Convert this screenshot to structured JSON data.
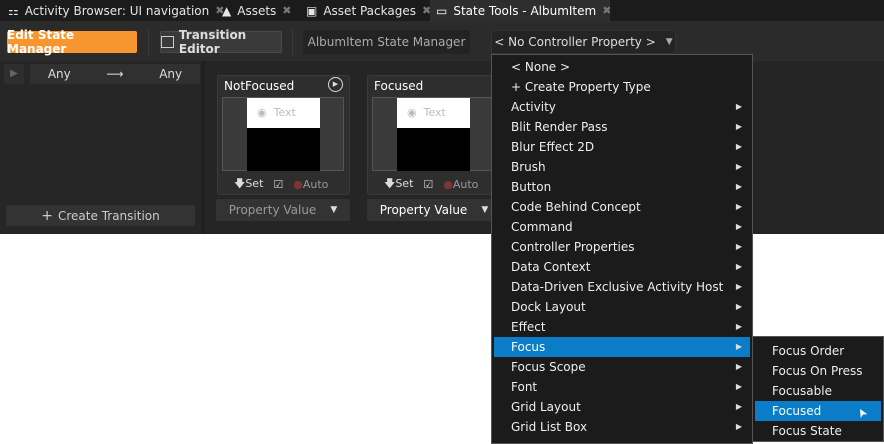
{
  "tabs": [
    {
      "label": "Activity Browser: UI navigation",
      "icon": "hierarchy-icon"
    },
    {
      "label": "Assets",
      "icon": "assets-icon"
    },
    {
      "label": "Asset Packages",
      "icon": "package-icon"
    },
    {
      "label": "State Tools - AlbumItem",
      "icon": "window-icon",
      "active": true
    }
  ],
  "toolbar": {
    "edit_state_manager": "Edit State Manager",
    "transition_editor": "Transition Editor",
    "state_manager_name": "AlbumItem State Manager",
    "controller_property": "< No Controller Property >"
  },
  "transitions": {
    "from": "Any",
    "to": "Any",
    "create": "Create Transition"
  },
  "states": [
    {
      "name": "NotFocused",
      "preview_text": "Text",
      "set": "Set",
      "auto": "Auto",
      "property_value": "Property Value"
    },
    {
      "name": "Focused",
      "preview_text": "Text",
      "set": "Set",
      "auto": "Auto",
      "property_value": "Property Value"
    }
  ],
  "menu": {
    "items": [
      {
        "label": "< None >",
        "sub": false
      },
      {
        "label": "+ Create Property Type",
        "sub": false
      },
      {
        "label": "Activity",
        "sub": true
      },
      {
        "label": "Blit Render Pass",
        "sub": true
      },
      {
        "label": "Blur Effect 2D",
        "sub": true
      },
      {
        "label": "Brush",
        "sub": true
      },
      {
        "label": "Button",
        "sub": true
      },
      {
        "label": "Code Behind Concept",
        "sub": true
      },
      {
        "label": "Command",
        "sub": true
      },
      {
        "label": "Controller Properties",
        "sub": true
      },
      {
        "label": "Data Context",
        "sub": true
      },
      {
        "label": "Data-Driven Exclusive Activity Host",
        "sub": true
      },
      {
        "label": "Dock Layout",
        "sub": true
      },
      {
        "label": "Effect",
        "sub": true
      },
      {
        "label": "Focus",
        "sub": true,
        "highlighted": true
      },
      {
        "label": "Focus Scope",
        "sub": true
      },
      {
        "label": "Font",
        "sub": true
      },
      {
        "label": "Grid Layout",
        "sub": true
      },
      {
        "label": "Grid List Box",
        "sub": true
      }
    ]
  },
  "submenu": {
    "items": [
      {
        "label": "Focus Order"
      },
      {
        "label": "Focus On Press"
      },
      {
        "label": "Focusable"
      },
      {
        "label": "Focused",
        "highlighted": true
      },
      {
        "label": "Focus State"
      }
    ]
  },
  "colors": {
    "accent": "#f7962e",
    "highlight": "#0a7cc8"
  }
}
